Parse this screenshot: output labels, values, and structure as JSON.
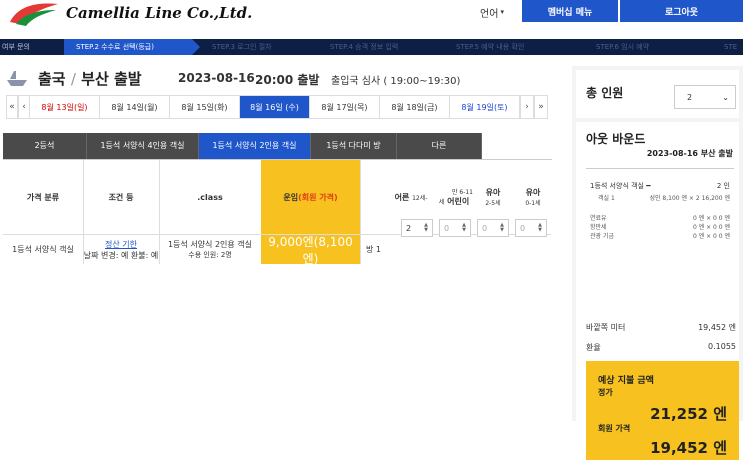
{
  "header": {
    "logo_text": "Camellia Line Co.,Ltd.",
    "lang_label": "언어",
    "member_menu": "멤버십 메뉴",
    "login": "로그아웃",
    "brand_color": "#1f56c9",
    "logo_color": "#e53935",
    "logo_accent": "#1a8f3c"
  },
  "steps": [
    {
      "label": "여부 문의",
      "state": "done"
    },
    {
      "label": "STEP.2 수수료 선택(등급)",
      "state": "active"
    },
    {
      "label": "STEP.3 로그인 절차",
      "state": "todo"
    },
    {
      "label": "STEP.4 승객 정보 입력",
      "state": "todo"
    },
    {
      "label": "STEP.5 예약 내용 확인",
      "state": "todo"
    },
    {
      "label": "STEP.6 임시 예약",
      "state": "todo"
    },
    {
      "label": "STE",
      "state": "todo"
    }
  ],
  "route": {
    "direction": "출국",
    "slash": "/",
    "origin": "부산 출발",
    "date": "2023-08-16",
    "time": "20:00 출발",
    "immigration": "출입국 심사 ( 19:00~19:30)"
  },
  "dates": {
    "prev_all": "«",
    "prev": "‹",
    "next": "›",
    "next_all": "»",
    "days": [
      {
        "label": "8월 13일(일)",
        "kind": "sun"
      },
      {
        "label": "8월 14일(월)",
        "kind": "weekday"
      },
      {
        "label": "8월 15일(화)",
        "kind": "weekday"
      },
      {
        "label": "8월 16일 (수)",
        "kind": "active"
      },
      {
        "label": "8월 17일(목)",
        "kind": "weekday"
      },
      {
        "label": "8월 18일(금)",
        "kind": "weekday"
      },
      {
        "label": "8월 19일(토)",
        "kind": "sat"
      }
    ]
  },
  "grade_tabs": [
    {
      "label": "2등석",
      "active": false
    },
    {
      "label": "1등석 서양식 4인용 객실",
      "active": false
    },
    {
      "label": "1등석 서양식 2인용 객실",
      "active": true
    },
    {
      "label": "1등석 다다미 방",
      "active": false
    },
    {
      "label": "다른",
      "active": false
    }
  ],
  "table": {
    "headers": {
      "price_class": "가격 분류",
      "conditions": "조건 등",
      "class": ".class",
      "fare": "운임",
      "fare_member": "(회원 가격)",
      "adult": "어른",
      "adult_age": "12세-",
      "child": "어린이",
      "child_age_top": "만 6-11",
      "child_age": "세",
      "infant1": "유아",
      "infant1_age": "2-5세",
      "infant2": "유아",
      "infant2_age": "0-1세"
    },
    "row": {
      "price_class": "1등석 서양식 객실",
      "refund_link": "정산 기한",
      "conditions": "날짜 변경: 예 환불: 예",
      "class_name": "1등석 서양식 2인용 객실",
      "capacity": "수용 인원: 2명",
      "price": "9,000엔(8,100엔)",
      "room": "방 1",
      "adult": "2",
      "child": "0",
      "infant1": "0",
      "infant2": "0"
    }
  },
  "sidebar": {
    "total_label": "총 인원",
    "total_value": "2",
    "outbound_title": "아웃 바운드",
    "outbound_date": "2023-08-16 부산 출발",
    "room_type": "1등석 서양식 객실 ━",
    "room_count": "2 인",
    "room_line": "객실 1",
    "room_line_detail": "성인 8,100 엔 × 2 16,200 엔",
    "fuel": "연료유",
    "fuel_value": "0 엔 × 0 0 엔",
    "port": "항만세",
    "port_value": "0 엔 × 0 0 엔",
    "tour": "관광 기금",
    "tour_value": "0 엔 × 0 0 엔",
    "meter_label": "바깥쪽 미터",
    "meter_value": "19,452 엔",
    "rate_label": "환율",
    "rate_value": "0.1055",
    "pay_title": "예상 지불 금액",
    "pay_regular_label": "정가",
    "pay_regular": "21,252 엔",
    "pay_member_label": "회원 가격",
    "pay_member": "19,452 엔"
  }
}
